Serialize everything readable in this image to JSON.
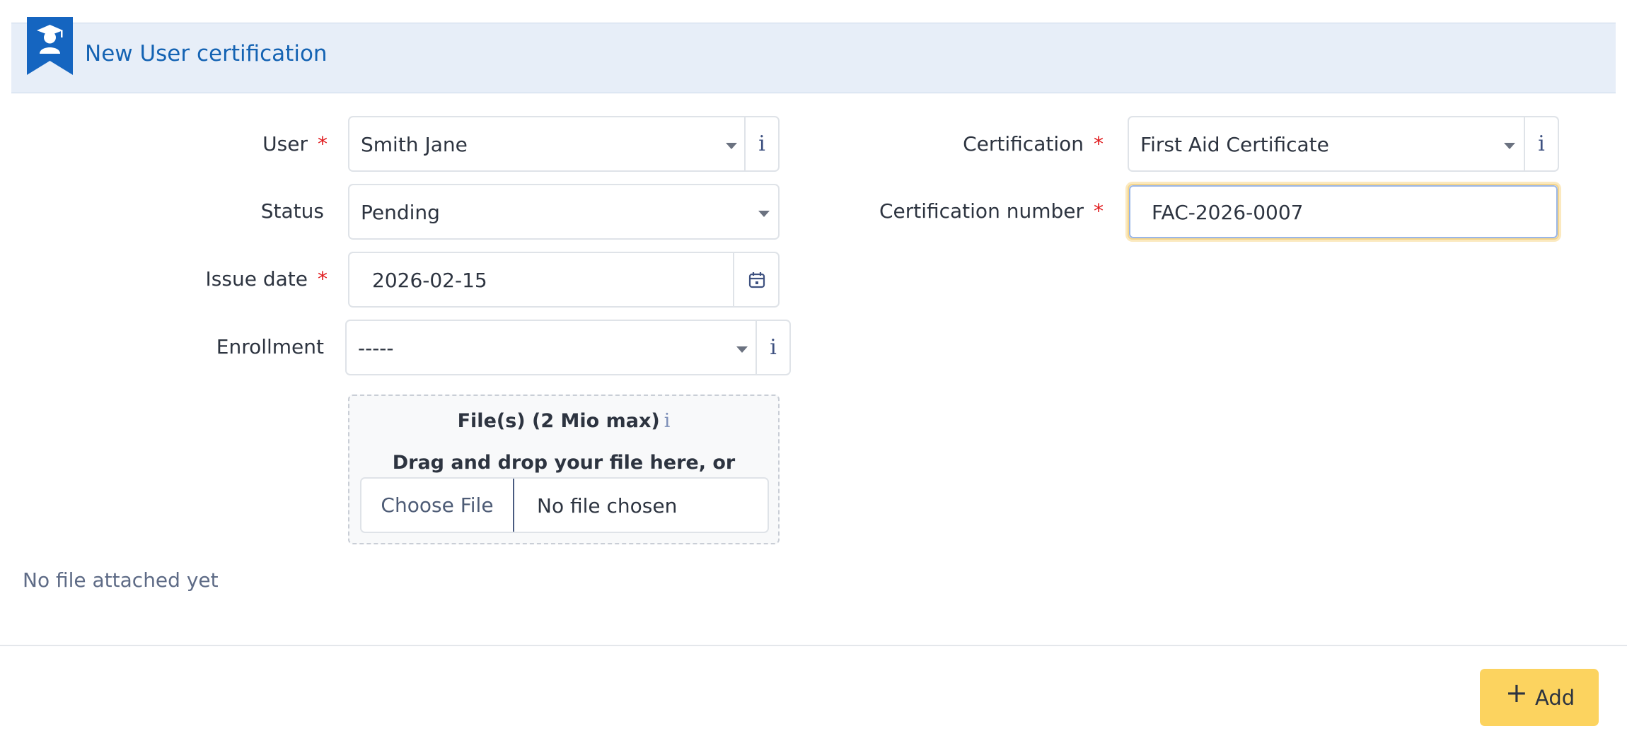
{
  "header": {
    "title": "New User certification",
    "icon": "graduate-bookmark-icon",
    "accent": "#1565c0"
  },
  "form": {
    "user": {
      "label": "User",
      "required": "*",
      "value": "Smith Jane",
      "info": "i"
    },
    "status": {
      "label": "Status",
      "value": "Pending"
    },
    "issue_date": {
      "label": "Issue date",
      "required": "*",
      "value": "2026-02-15",
      "icon": "calendar-icon"
    },
    "enrollment": {
      "label": "Enrollment",
      "value": "-----",
      "info": "i"
    },
    "certification": {
      "label": "Certification",
      "required": "*",
      "value": "First Aid Certificate",
      "info": "i"
    },
    "certification_number": {
      "label": "Certification number",
      "required": "*",
      "value": "FAC-2026-0007"
    }
  },
  "upload": {
    "title": "File(s) (2 Mio max)",
    "info": "i",
    "hint": "Drag and drop your file here, or",
    "choose_label": "Choose File",
    "no_file_label": "No file chosen"
  },
  "attachments": {
    "empty_text": "No file attached yet"
  },
  "actions": {
    "add_icon": "+",
    "add_label": "Add",
    "add_color": "#fcd35f"
  }
}
